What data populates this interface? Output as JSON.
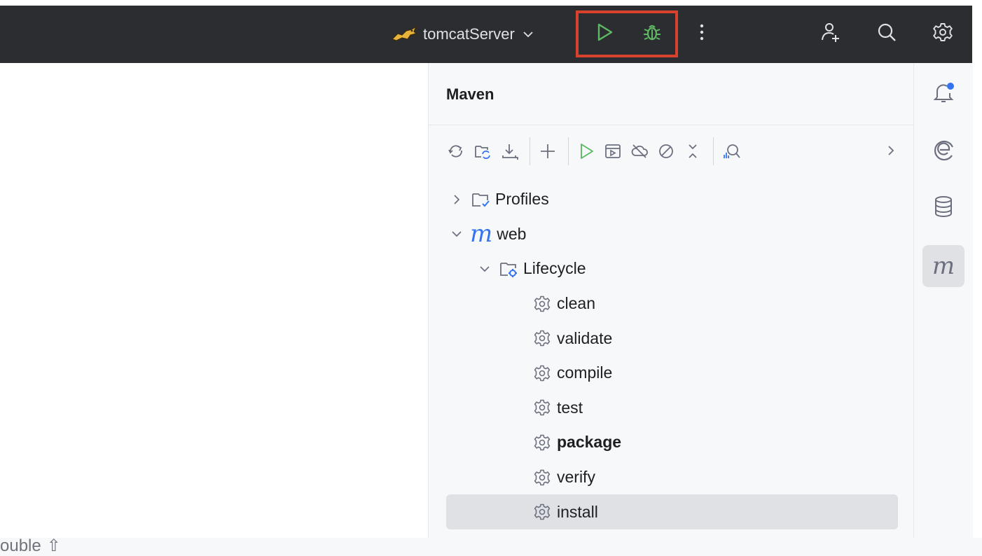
{
  "titlebar": {
    "run_configuration": "tomcatServer",
    "icons": [
      "tomcat-icon",
      "chevron-down-icon",
      "run-icon",
      "debug-icon",
      "more-vertical-icon",
      "add-user-icon",
      "search-icon",
      "settings-icon"
    ]
  },
  "editor": {
    "hint_text": "ouble",
    "hint_key": "⇧"
  },
  "maven": {
    "title": "Maven",
    "toolbar_icons": [
      "reload-icon",
      "reimport-folder-icon",
      "download-icon",
      "add-icon",
      "run-icon",
      "execute-goal-icon",
      "offline-mode-icon",
      "skip-tests-icon",
      "collapse-all-icon",
      "analyze-dependencies-icon",
      "chevron-right-icon"
    ],
    "tree": {
      "profiles": "Profiles",
      "project": "web",
      "lifecycle": "Lifecycle",
      "goals": [
        "clean",
        "validate",
        "compile",
        "test",
        "package",
        "verify",
        "install"
      ],
      "bold_goal": "package",
      "selected_goal": "install"
    }
  },
  "right_strip": {
    "icons": [
      "notifications-icon",
      "ai-assistant-icon",
      "database-icon",
      "maven-icon"
    ],
    "maven_letter": "m"
  },
  "colors": {
    "titlebar_bg": "#2b2d30",
    "highlight": "#d9412f",
    "run_green": "#5fb865",
    "accent_blue": "#3574f0"
  }
}
